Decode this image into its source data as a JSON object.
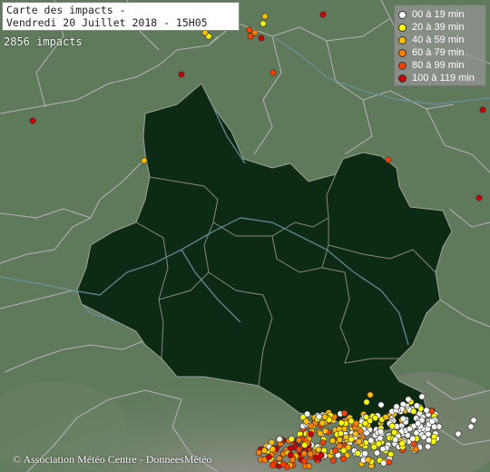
{
  "title": {
    "line1": "Carte des impacts -",
    "line2": "Vendredi 20 Juillet 2018 - 15H05"
  },
  "impacts_count": "2856 impacts",
  "legend": {
    "items": [
      {
        "label": "00 à 19 min",
        "color": "#ffffff"
      },
      {
        "label": "20 à 39 min",
        "color": "#ffff00"
      },
      {
        "label": "40 à 59 min",
        "color": "#ffbf00"
      },
      {
        "label": "60 à 79 min",
        "color": "#ff7f00"
      },
      {
        "label": "80 à 99 min",
        "color": "#ff3f00"
      },
      {
        "label": "100 à 119 min",
        "color": "#cc0000"
      }
    ]
  },
  "credit": "© Association Météo Centre - DonneesMétéo",
  "colors": {
    "region_fill": "#0d2a13",
    "terrain": "#5f7a5c",
    "border": "#b9b9b9",
    "river": "#6f90a8"
  }
}
